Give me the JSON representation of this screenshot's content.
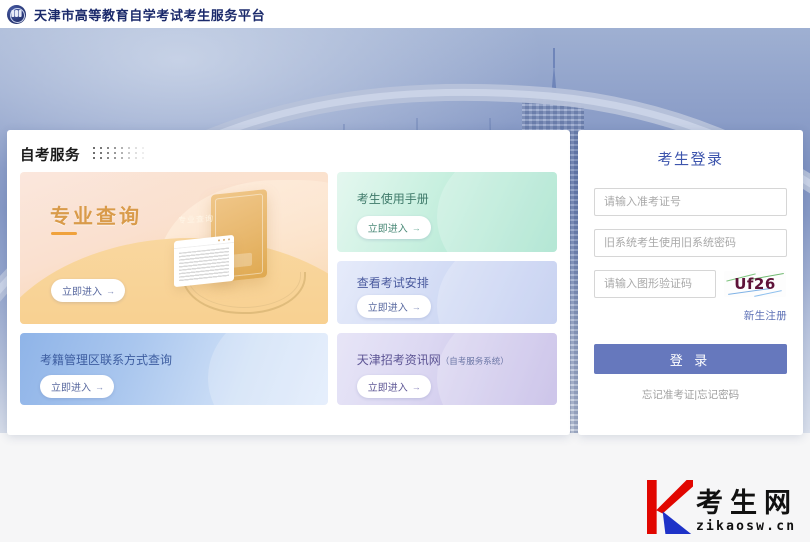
{
  "header": {
    "logo_icon": "circle-emblem-icon",
    "title": "天津市高等教育自学考试考生服务平台"
  },
  "service": {
    "title": "自考服务",
    "decoration": "dot-grid-decoration",
    "tiles": {
      "major_query": {
        "title": "专业查询",
        "illustration_label": "专业查询",
        "button": "立即进入",
        "arrow": "→"
      },
      "manual": {
        "title": "考生使用手册",
        "button": "立即进入",
        "arrow": "→"
      },
      "schedule": {
        "title": "查看考试安排",
        "button": "立即进入",
        "arrow": "→"
      },
      "contact": {
        "title": "考籍管理区联系方式查询",
        "button": "立即进入",
        "arrow": "→"
      },
      "info_site": {
        "title": "天津招考资讯网",
        "subtitle": "（自考服务系统）",
        "button": "立即进入",
        "arrow": "→"
      }
    }
  },
  "login": {
    "title": "考生登录",
    "username_placeholder": "请输入准考证号",
    "username_value": "",
    "password_placeholder": "旧系统考生使用旧系统密码",
    "password_value": "",
    "captcha_placeholder": "请输入图形验证码",
    "captcha_value": "",
    "captcha_image_text": "Uf26",
    "register_link": "新生注册",
    "submit_button": "登 录",
    "forgot_links": "忘记准考证|忘记密码"
  },
  "watermark": {
    "mark": "K",
    "chinese": "考生网",
    "url": "zikaosw.cn"
  },
  "colors": {
    "brand_navy": "#1b2a6b",
    "login_title": "#3d55ad",
    "login_button": "#6678bd",
    "major_gold": "#d99b4a",
    "watermark_red": "#e10600",
    "watermark_blue": "#1e32c8"
  }
}
